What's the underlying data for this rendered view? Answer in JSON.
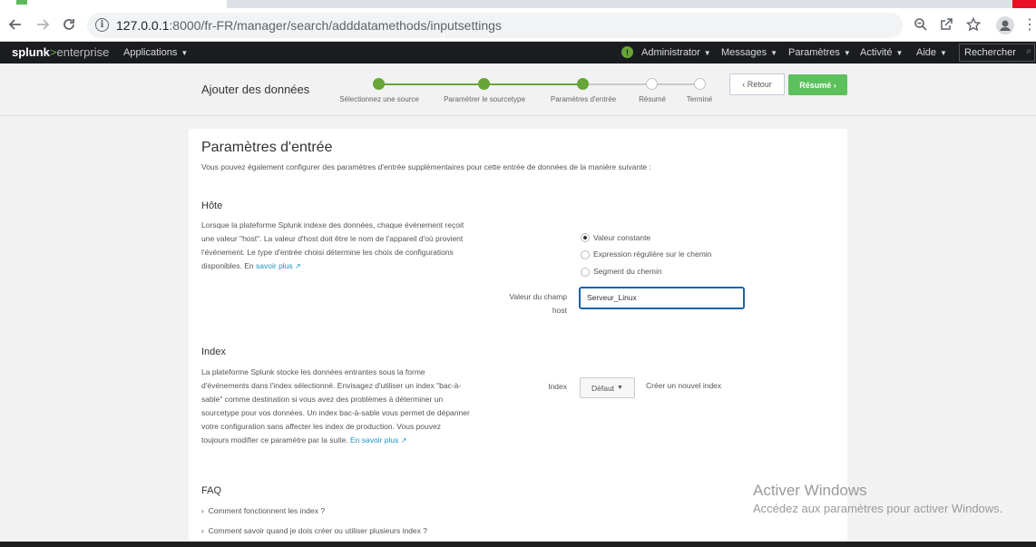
{
  "browser": {
    "url_host": "127.0.0.1",
    "url_rest": ":8000/fr-FR/manager/search/adddatamethods/inputsettings"
  },
  "splunk_nav": {
    "logo_splunk": "splunk",
    "logo_gt": ">",
    "logo_enterprise": "enterprise",
    "applications": "Applications",
    "administrator": "Administrator",
    "messages": "Messages",
    "parametres": "Paramètres",
    "activite": "Activité",
    "aide": "Aide",
    "search": "Rechercher"
  },
  "wizard": {
    "title": "Ajouter des données",
    "steps": [
      {
        "label": "Sélectionnez une source",
        "done": true
      },
      {
        "label": "Paramétrer le sourcetype",
        "done": true
      },
      {
        "label": "Paramètres d'entrée",
        "done": true
      },
      {
        "label": "Résumé",
        "done": false
      },
      {
        "label": "Terminé",
        "done": false
      }
    ],
    "back_label": "Retour",
    "next_label": "Résumé"
  },
  "main": {
    "title": "Paramètres d'entrée",
    "subtitle": "Vous pouvez également configurer des paramètres d'entrée supplémentaires pour cette entrée de données de la manière suivante :",
    "host": {
      "title": "Hôte",
      "description": "Lorsque la plateforme Splunk indexe des données, chaque événement reçoit une valeur \"host\". La valeur d'host doit être le nom de l'appareil d'où provient l'événement. Le type d'entrée choisi détermine les choix de configurations disponibles. En",
      "learn_more": "savoir plus",
      "options": [
        {
          "label": "Valeur constante",
          "selected": true
        },
        {
          "label": "Expression régulière sur le chemin",
          "selected": false
        },
        {
          "label": "Segment du chemin",
          "selected": false
        }
      ],
      "field_label_line1": "Valeur du champ",
      "field_label_line2": "host",
      "field_value": "Serveur_Linux"
    },
    "index": {
      "title": "Index",
      "description": "La plateforme Splunk stocke les données entrantes sous la forme d'événements dans l'index sélectionné. Envisagez d'utiliser un index \"bac-à-sable\" comme destination si vous avez des problèmes à déterminer un sourcetype pour vos données. Un index bac-à-sable vous permet de dépanner votre configuration sans affecter les index de production. Vous pouvez toujours modifier ce paramètre par la suite.",
      "learn_more": "En savoir plus",
      "field_label": "Index",
      "dropdown_value": "Défaut",
      "create_link": "Créer un nouvel index"
    },
    "faq": {
      "title": "FAQ",
      "items": [
        "Comment fonctionnent les index ?",
        "Comment savoir quand je dois créer ou utiliser plusieurs index ?"
      ]
    }
  },
  "watermark": {
    "line1": "Activer Windows",
    "line2": "Accédez aux paramètres pour activer Windows."
  }
}
